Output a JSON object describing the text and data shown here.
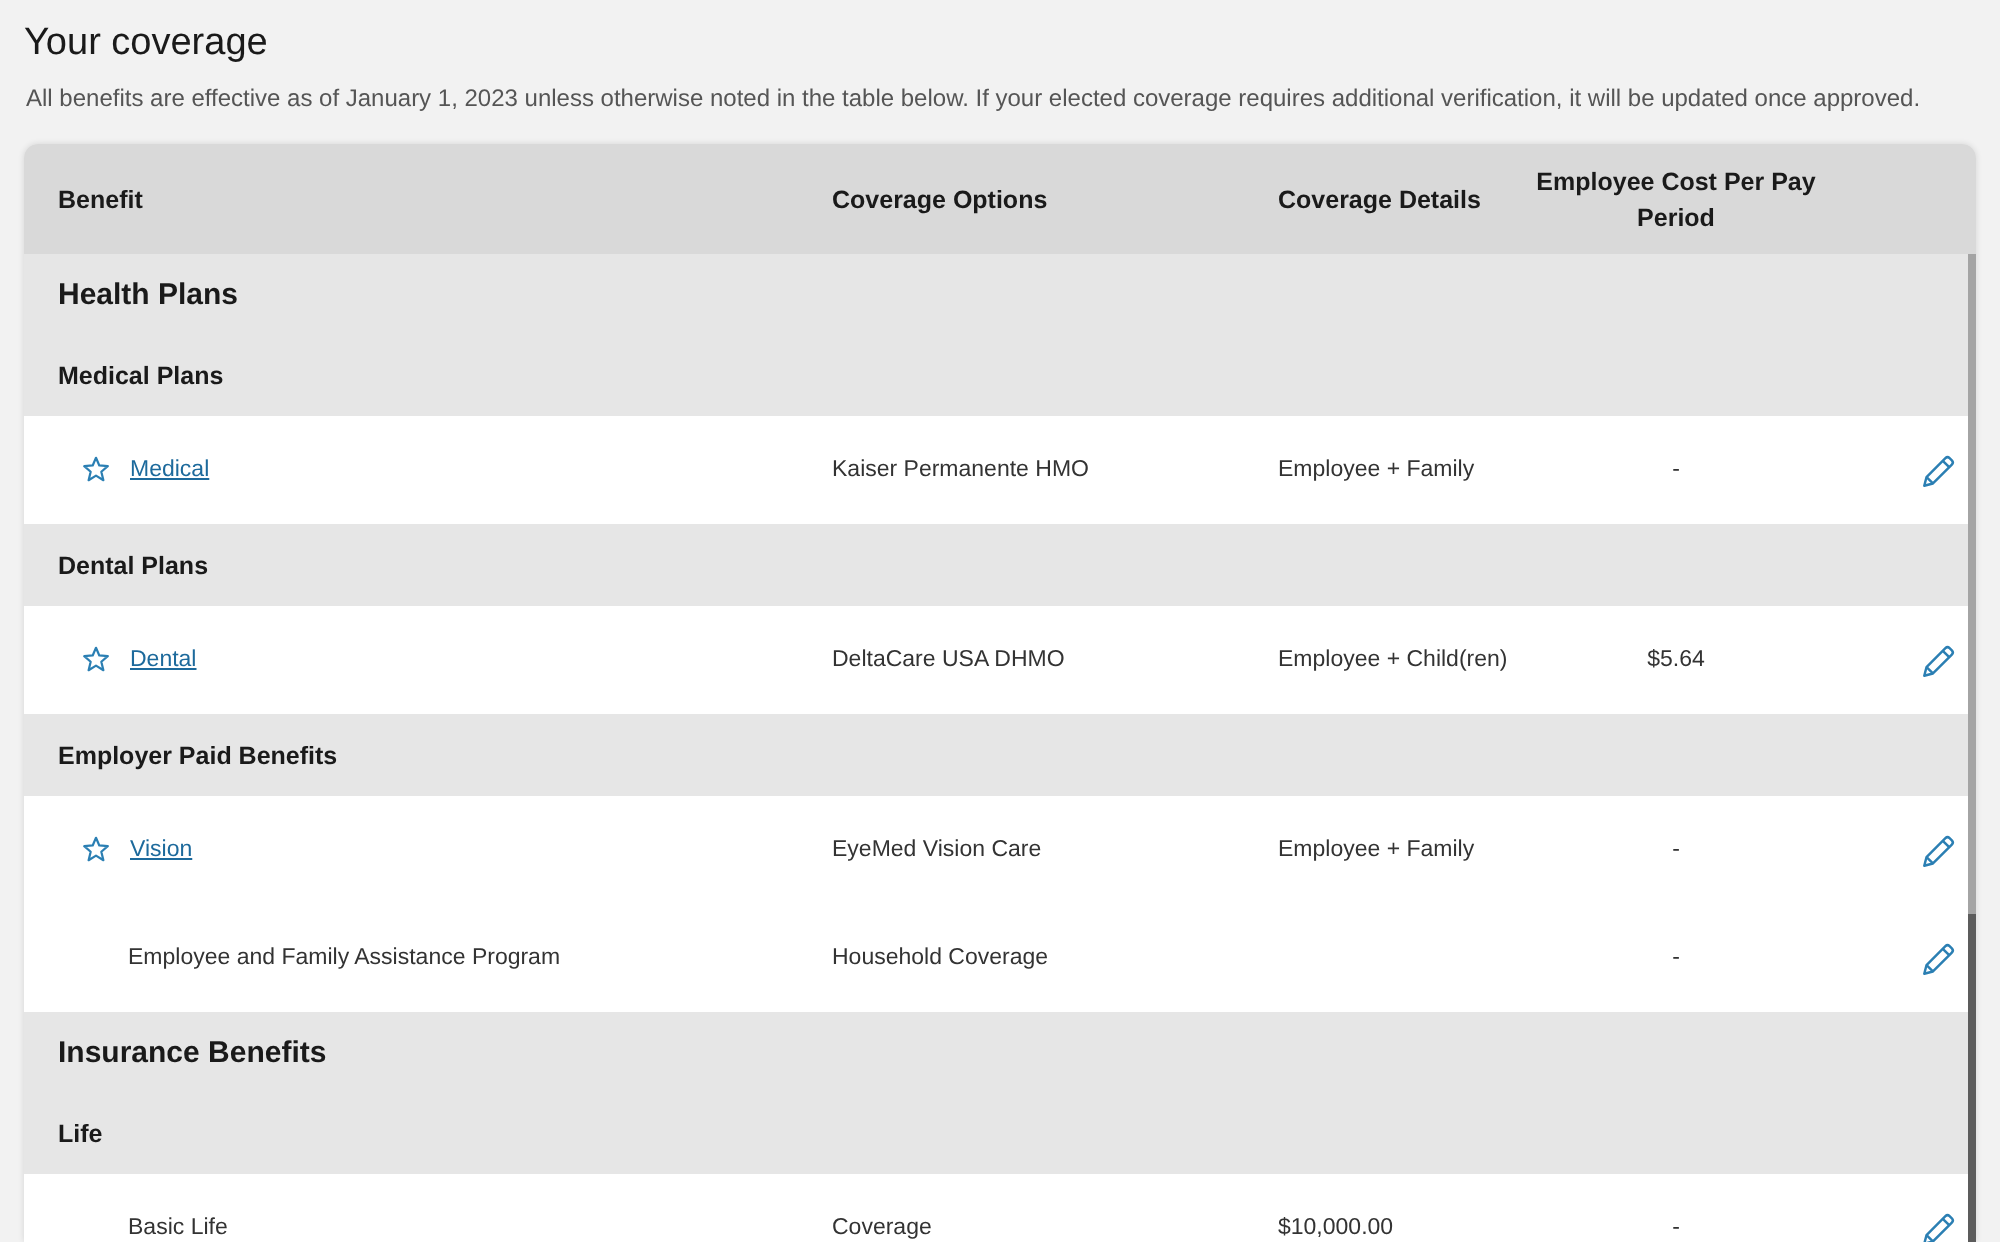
{
  "page": {
    "title": "Your coverage",
    "subtitle": "All benefits are effective as of January 1, 2023 unless otherwise noted in the table below. If your elected coverage requires additional verification, it will be updated once approved."
  },
  "table": {
    "columns": [
      "Benefit",
      "Coverage Options",
      "Coverage Details",
      "Employee Cost Per Pay Period"
    ],
    "sections": [
      {
        "title": "Health Plans",
        "groups": [
          {
            "title": "Medical Plans",
            "rows": [
              {
                "kind": "link",
                "benefit": "Medical",
                "coverage_option": "Kaiser Permanente HMO",
                "coverage_details": "Employee + Family",
                "cost": "-"
              }
            ]
          },
          {
            "title": "Dental Plans",
            "rows": [
              {
                "kind": "link",
                "benefit": "Dental",
                "coverage_option": "DeltaCare USA DHMO",
                "coverage_details": "Employee + Child(ren)",
                "cost": "$5.64"
              }
            ]
          },
          {
            "title": "Employer Paid Benefits",
            "rows": [
              {
                "kind": "link",
                "benefit": "Vision",
                "coverage_option": "EyeMed Vision Care",
                "coverage_details": "Employee + Family",
                "cost": "-"
              },
              {
                "kind": "plain",
                "benefit": "Employee and Family Assistance Program",
                "coverage_option": "Household Coverage",
                "cost": "-"
              }
            ]
          }
        ]
      },
      {
        "title": "Insurance Benefits",
        "groups": [
          {
            "title": "Life",
            "rows": [
              {
                "kind": "plain",
                "benefit": "Basic Life",
                "coverage_option": "Coverage",
                "coverage_details": "$10,000.00",
                "cost": "-"
              }
            ]
          }
        ]
      }
    ]
  }
}
